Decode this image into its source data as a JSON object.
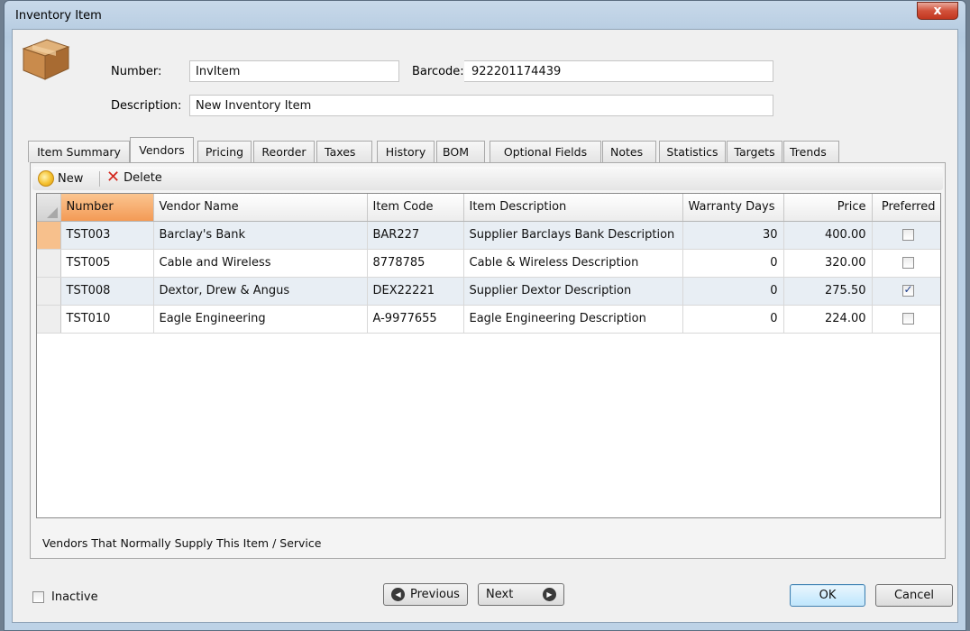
{
  "window": {
    "title": "Inventory Item",
    "close_glyph": "x"
  },
  "header": {
    "number_label": "Number:",
    "number_value": "InvItem",
    "barcode_label": "Barcode:",
    "barcode_value": "922201174439",
    "description_label": "Description:",
    "description_value": "New Inventory Item",
    "icon": "package-box-icon"
  },
  "tabs": [
    {
      "label": "Item Summary"
    },
    {
      "label": "Vendors",
      "active": true
    },
    {
      "label": "Pricing"
    },
    {
      "label": "Reorder"
    },
    {
      "label": "Taxes"
    },
    {
      "label": "History"
    },
    {
      "label": "BOM"
    },
    {
      "label": "Optional Fields"
    },
    {
      "label": "Notes"
    },
    {
      "label": "Statistics"
    },
    {
      "label": "Targets"
    },
    {
      "label": "Trends"
    }
  ],
  "toolbar": {
    "new_label": "New",
    "delete_label": "Delete"
  },
  "grid": {
    "columns": [
      "Number",
      "Vendor Name",
      "Item Code",
      "Item Description",
      "Warranty Days",
      "Price",
      "Preferred"
    ],
    "rows": [
      {
        "number": "TST003",
        "vendor": "Barclay's Bank",
        "code": "BAR227",
        "description": "Supplier Barclays Bank Description",
        "warranty": "30",
        "price": "400.00",
        "preferred": false
      },
      {
        "number": "TST005",
        "vendor": "Cable and Wireless",
        "code": "8778785",
        "description": "Cable & Wireless Description",
        "warranty": "0",
        "price": "320.00",
        "preferred": false
      },
      {
        "number": "TST008",
        "vendor": "Dextor, Drew & Angus",
        "code": "DEX22221",
        "description": "Supplier Dextor Description",
        "warranty": "0",
        "price": "275.50",
        "preferred": true
      },
      {
        "number": "TST010",
        "vendor": "Eagle Engineering",
        "code": "A-9977655",
        "description": "Eagle Engineering Description",
        "warranty": "0",
        "price": "224.00",
        "preferred": false
      }
    ]
  },
  "panel_caption": "Vendors That Normally Supply This Item / Service",
  "footer": {
    "inactive_label": "Inactive",
    "inactive_checked": false,
    "previous_label": "Previous",
    "next_label": "Next",
    "ok_label": "OK",
    "cancel_label": "Cancel"
  },
  "colors": {
    "selected_column": "#f39a55",
    "alt_row": "#e8eef4",
    "ok_button": "#bee6fd"
  }
}
